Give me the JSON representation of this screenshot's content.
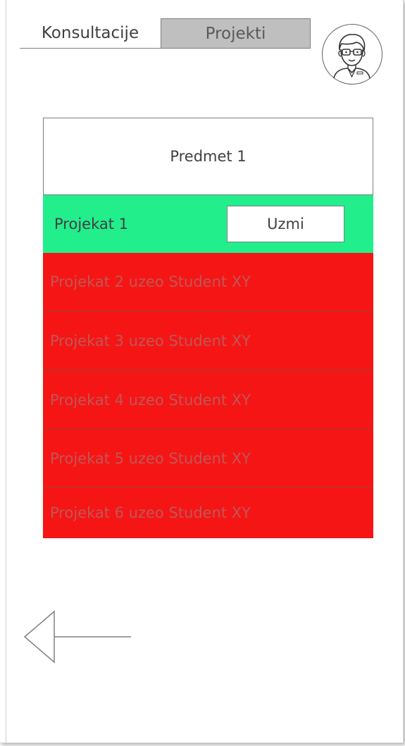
{
  "tabs": {
    "consultations": "Konsultacije",
    "projects": "Projekti"
  },
  "subject": {
    "title": "Predmet 1"
  },
  "available_project": {
    "label": "Projekat 1",
    "take_label": "Uzmi"
  },
  "taken_projects": [
    {
      "label": "Projekat 2 uzeo Student XY"
    },
    {
      "label": "Projekat 3 uzeo Student XY"
    },
    {
      "label": "Projekat 4 uzeo Student XY"
    },
    {
      "label": "Projekat 5 uzeo Student XY"
    },
    {
      "label": "Projekat 6 uzeo Student XY"
    }
  ],
  "icons": {
    "avatar": "user-avatar-icon",
    "back": "back-arrow-icon"
  },
  "colors": {
    "available": "#22ee8c",
    "taken": "#f51515",
    "active_tab": "#bfbfbf"
  }
}
